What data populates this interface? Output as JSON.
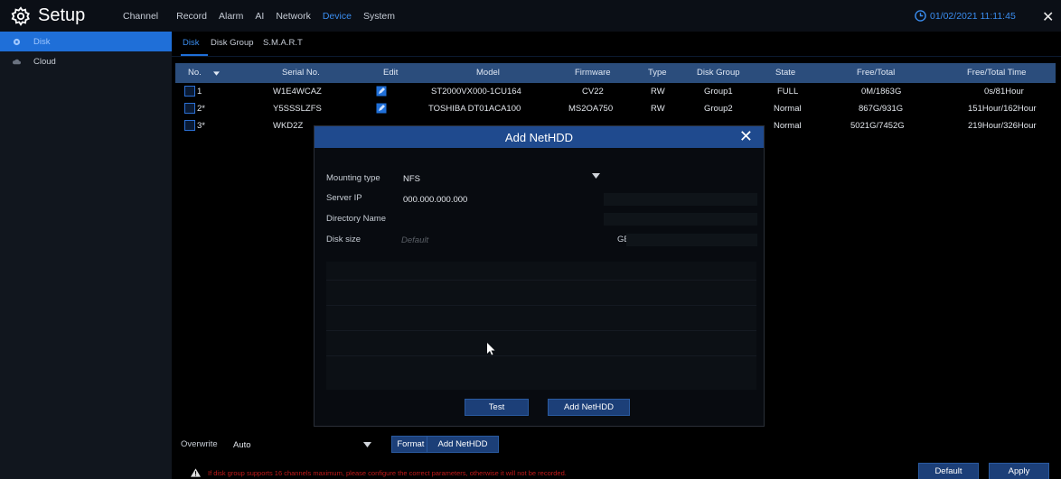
{
  "app": {
    "title": "Setup",
    "clock": "01/02/2021 11:11:45"
  },
  "menu": [
    "Channel",
    "Record",
    "Alarm",
    "AI",
    "Network",
    "Device",
    "System"
  ],
  "menu_active": "Device",
  "sidebar": {
    "items": [
      {
        "label": "Disk",
        "active": true
      },
      {
        "label": "Cloud",
        "active": false
      }
    ]
  },
  "subtabs": [
    "Disk",
    "Disk Group",
    "S.M.A.R.T"
  ],
  "table": {
    "headers": [
      "No.",
      "Serial No.",
      "Edit",
      "Model",
      "Firmware",
      "Type",
      "Disk Group",
      "State",
      "Free/Total",
      "Free/Total Time"
    ],
    "rows": [
      {
        "no": "1",
        "serial": "W1E4WCAZ",
        "model": "ST2000VX000-1CU164",
        "firmware": "CV22",
        "type": "RW",
        "group": "Group1",
        "state": "FULL",
        "free_total": "0M/1863G",
        "free_time": "0s/81Hour"
      },
      {
        "no": "2*",
        "serial": "Y5SSSLZFS",
        "model": "TOSHIBA DT01ACA100",
        "firmware": "MS2OA750",
        "type": "RW",
        "group": "Group2",
        "state": "Normal",
        "free_total": "867G/931G",
        "free_time": "151Hour/162Hour"
      },
      {
        "no": "3*",
        "serial": "WKD2Z",
        "model": "",
        "firmware": "",
        "type": "",
        "group": "",
        "state": "Normal",
        "free_total": "5021G/7452G",
        "free_time": "219Hour/326Hour"
      }
    ]
  },
  "modal": {
    "title": "Add NetHDD",
    "mounting_type_label": "Mounting type",
    "mounting_type_value": "NFS",
    "server_ip_label": "Server IP",
    "server_ip_value": "000.000.000.000",
    "directory_label": "Directory Name",
    "disk_size_label": "Disk size",
    "disk_size_placeholder": "Default",
    "disk_size_unit": "GB",
    "test_button": "Test",
    "add_button": "Add NetHDD"
  },
  "bottom": {
    "overwrite_label": "Overwrite",
    "overwrite_value": "Auto",
    "format_button": "Format HDD",
    "add_button": "Add NetHDD",
    "default_button": "Default",
    "apply_button": "Apply",
    "warning": "If disk group supports 16 channels maximum, please configure the correct parameters, otherwise it will not be recorded."
  },
  "colors": {
    "accent": "#1f6fd8",
    "header": "#2b4d7c",
    "warning": "#c41a1a",
    "button": "#1c3f78"
  },
  "icons": [
    "gear-icon",
    "clock-icon",
    "close-icon",
    "disk-icon",
    "cloud-icon",
    "chevron-down-icon",
    "edit-icon",
    "warning-icon",
    "cursor-icon"
  ]
}
